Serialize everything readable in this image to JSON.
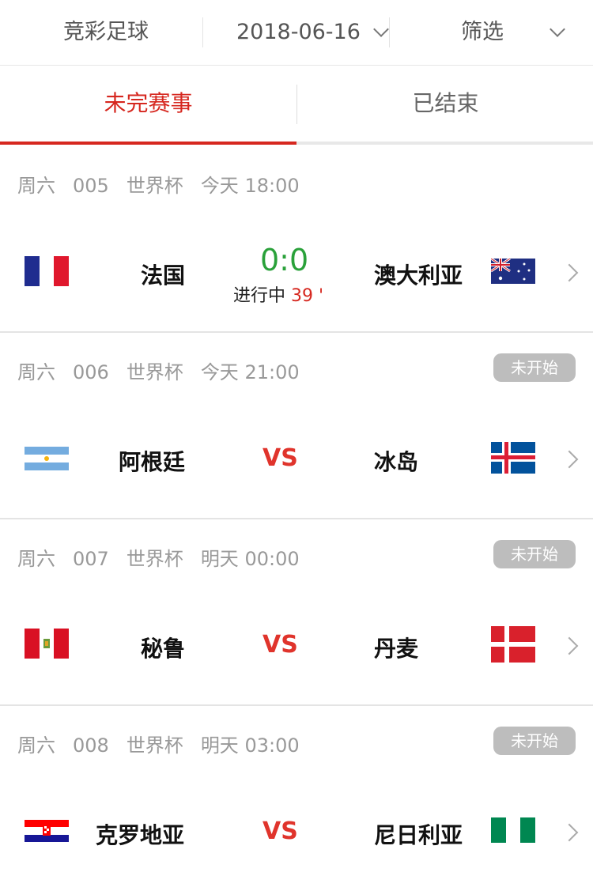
{
  "topbar": {
    "title": "竞彩足球",
    "date": "2018-06-16",
    "filter": "筛选"
  },
  "tabs": {
    "active": "未完赛事",
    "inactive": "已结束"
  },
  "matches": [
    {
      "day": "周六",
      "code": "005",
      "league": "世界杯",
      "time": "今天 18:00",
      "home": "法国",
      "away": "澳大利亚",
      "score": "0:0",
      "status": "进行中",
      "minute": "39 '",
      "home_flag": "france-flag",
      "away_flag": "australia-flag"
    },
    {
      "day": "周六",
      "code": "006",
      "league": "世界杯",
      "time": "今天 21:00",
      "home": "阿根廷",
      "away": "冰岛",
      "vs": "VS",
      "badge": "未开始",
      "home_flag": "argentina-flag",
      "away_flag": "iceland-flag"
    },
    {
      "day": "周六",
      "code": "007",
      "league": "世界杯",
      "time": "明天 00:00",
      "home": "秘鲁",
      "away": "丹麦",
      "vs": "VS",
      "badge": "未开始",
      "home_flag": "peru-flag",
      "away_flag": "denmark-flag"
    },
    {
      "day": "周六",
      "code": "008",
      "league": "世界杯",
      "time": "明天 03:00",
      "home": "克罗地亚",
      "away": "尼日利亚",
      "vs": "VS",
      "badge": "未开始",
      "home_flag": "croatia-flag",
      "away_flag": "nigeria-flag"
    }
  ],
  "colors": {
    "accent": "#d6271f",
    "score": "#2aa13a",
    "vs": "#e0342c"
  }
}
